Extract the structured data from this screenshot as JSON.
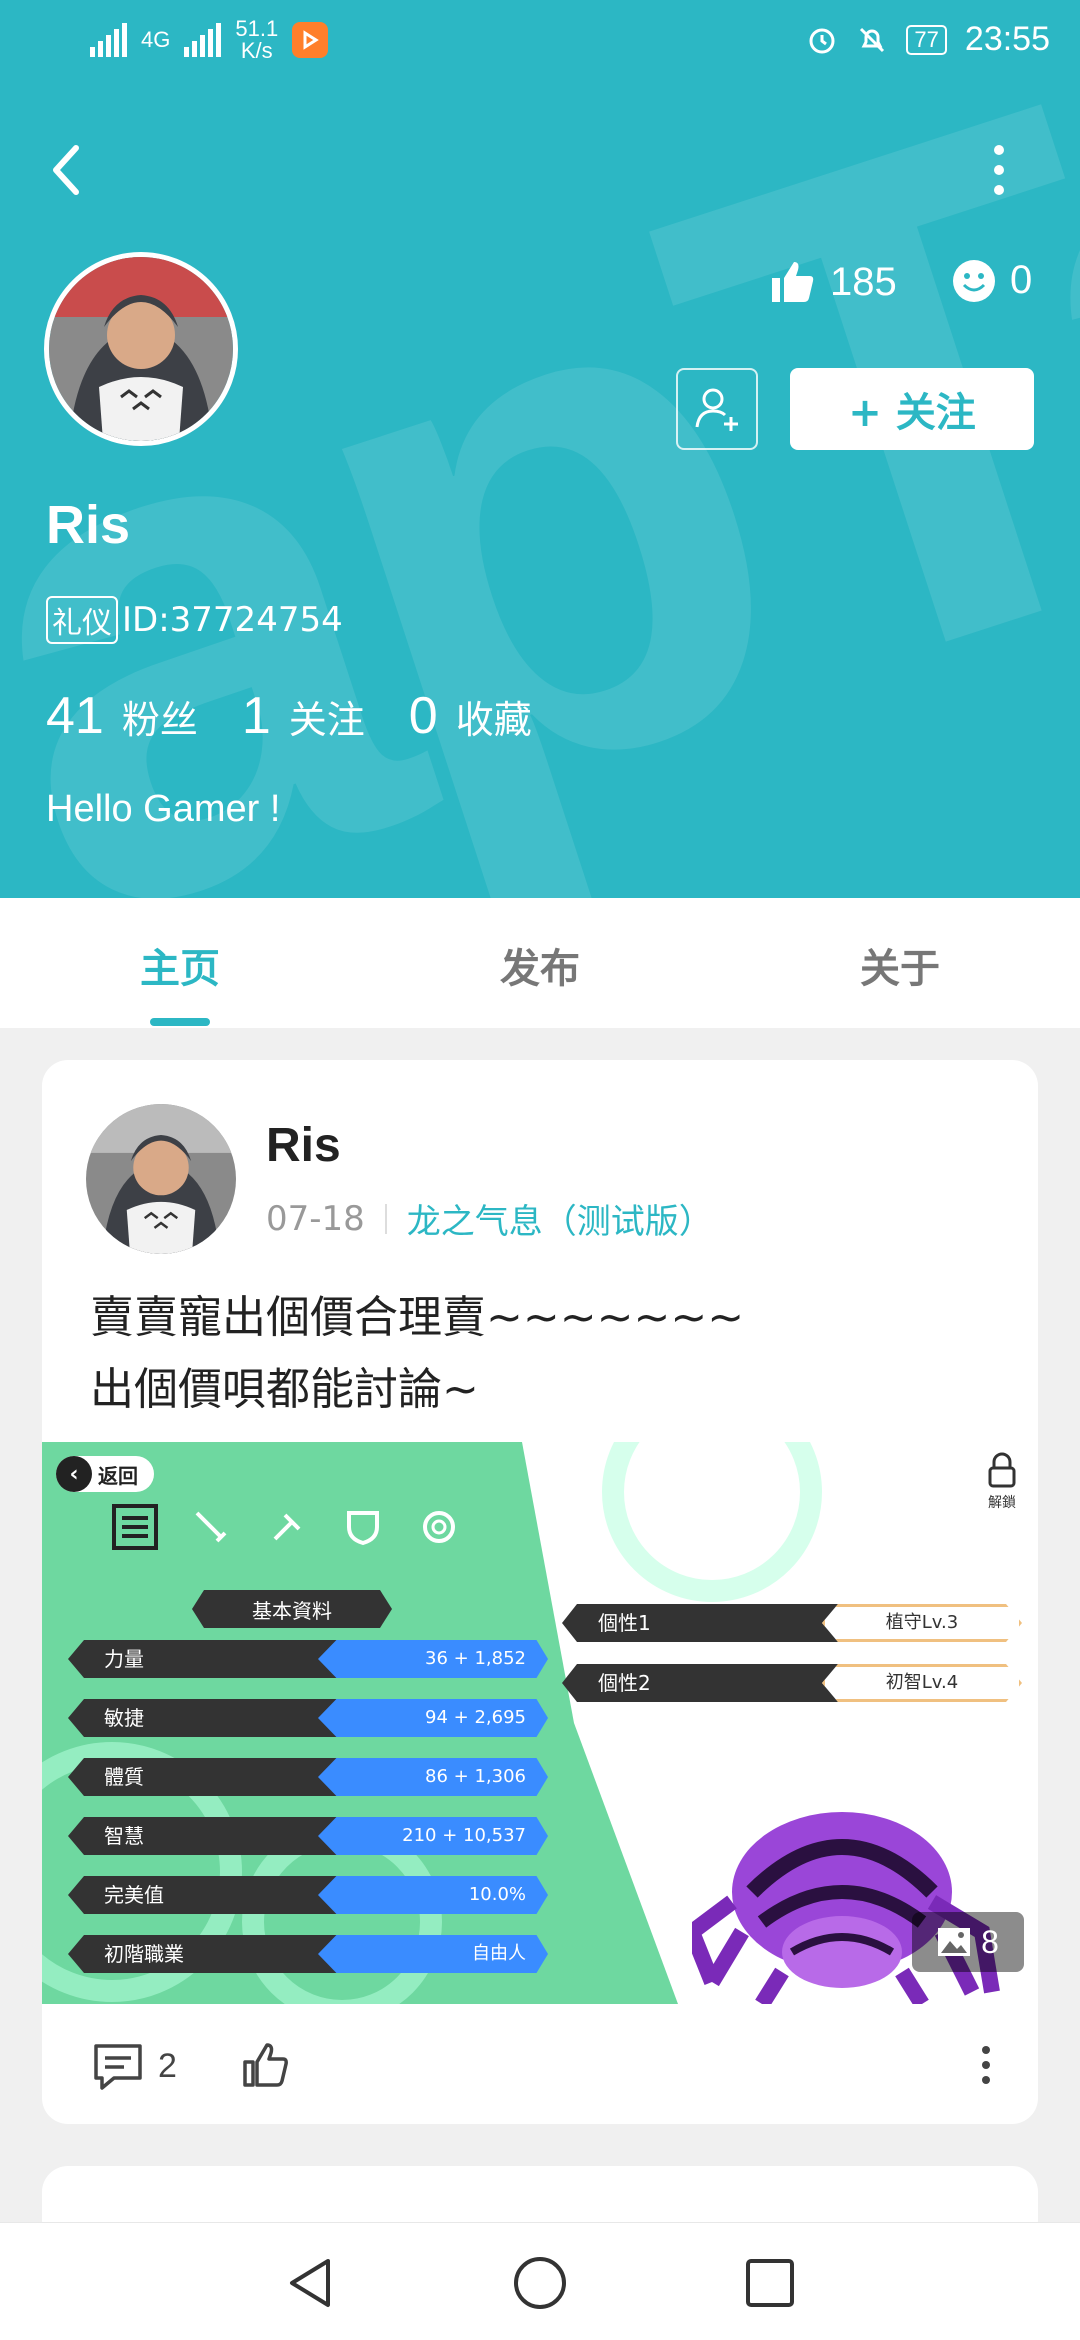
{
  "status_bar": {
    "net_speed_value": "51.1",
    "net_speed_unit": "K/s",
    "network": "4G",
    "battery": "77",
    "time": "23:55"
  },
  "profile": {
    "watermark": "apTa",
    "name": "Ris",
    "badge": "礼仪",
    "id": "ID:37724754",
    "likes": "185",
    "reactions": "0",
    "follow_label": "+ 关注",
    "followers_count": "41",
    "followers_label": "粉丝",
    "following_count": "1",
    "following_label": "关注",
    "favorites_count": "0",
    "favorites_label": "收藏",
    "bio": "Hello Gamer !"
  },
  "tabs": [
    {
      "label": "主页",
      "active": true
    },
    {
      "label": "发布",
      "active": false
    },
    {
      "label": "关于",
      "active": false
    }
  ],
  "post": {
    "author": "Ris",
    "date": "07-18",
    "game": "龙之气息（测试版）",
    "text_line1": "賣賣寵出個價合理賣~~~~~~~",
    "text_line2": "出個價唄都能討論~",
    "image_count": "8",
    "comments": "2",
    "game_screen": {
      "back_label": "返回",
      "lock_label": "解鎖",
      "section_title": "基本資料",
      "stats": [
        {
          "label": "力量",
          "value": "36 + 1,852"
        },
        {
          "label": "敏捷",
          "value": "94 + 2,695"
        },
        {
          "label": "體質",
          "value": "86 + 1,306"
        },
        {
          "label": "智慧",
          "value": "210 + 10,537"
        },
        {
          "label": "完美值",
          "value": "10.0%"
        },
        {
          "label": "初階職業",
          "value": "自由人"
        }
      ],
      "traits": [
        {
          "label": "個性1",
          "value": "植守Lv.3"
        },
        {
          "label": "個性2",
          "value": "初智Lv.4"
        }
      ]
    }
  },
  "colors": {
    "brand": "#2cb7c4",
    "game_green": "#6ed8a0",
    "stat_blue": "#3a8cff"
  }
}
